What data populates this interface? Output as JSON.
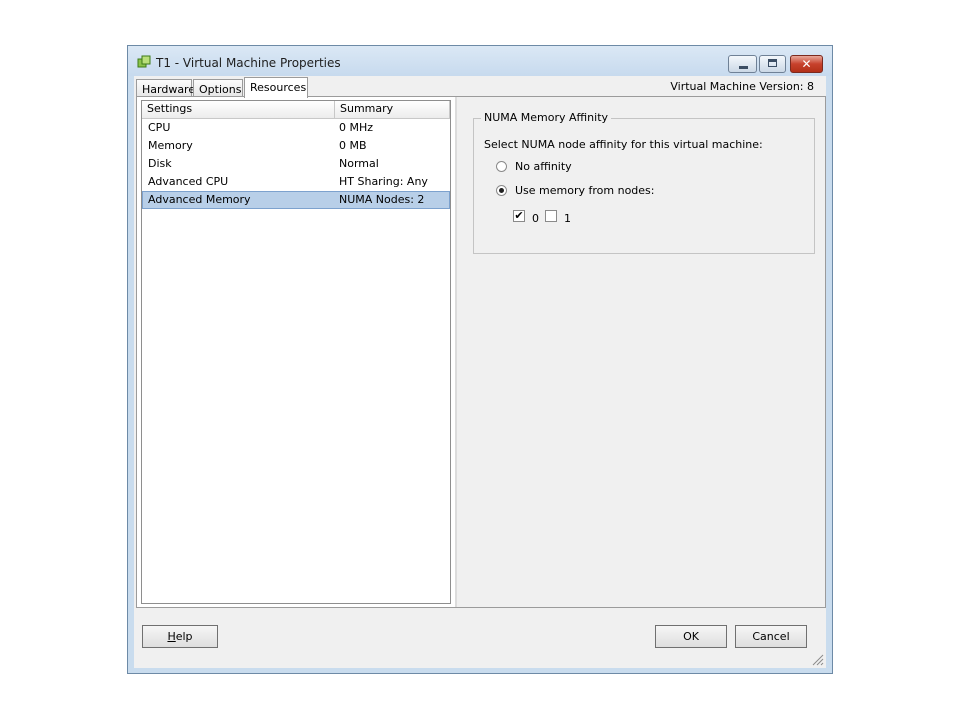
{
  "window": {
    "title": "T1 - Virtual Machine Properties",
    "close_symbol": "✕"
  },
  "tabs": [
    {
      "label": "Hardware",
      "active": false
    },
    {
      "label": "Options",
      "active": false
    },
    {
      "label": "Resources",
      "active": true
    }
  ],
  "vm_version": "Virtual Machine Version: 8",
  "list": {
    "headers": {
      "settings": "Settings",
      "summary": "Summary"
    },
    "rows": [
      {
        "setting": "CPU",
        "summary": "0 MHz"
      },
      {
        "setting": "Memory",
        "summary": "0 MB"
      },
      {
        "setting": "Disk",
        "summary": "Normal"
      },
      {
        "setting": "Advanced CPU",
        "summary": "HT Sharing: Any"
      },
      {
        "setting": "Advanced Memory",
        "summary": "NUMA Nodes: 2"
      }
    ],
    "selected_index": 4
  },
  "numa": {
    "group_title": "NUMA Memory Affinity",
    "description": "Select NUMA node affinity for this virtual machine:",
    "radio_no_affinity": "No affinity",
    "radio_use_nodes": "Use memory from nodes:",
    "selected_option": "use_nodes",
    "node0_label": "0",
    "node0_checked": true,
    "node1_label": "1",
    "node1_checked": false,
    "check_mark": "✔"
  },
  "buttons": {
    "help_underlined": "H",
    "help_rest": "elp",
    "ok": "OK",
    "cancel": "Cancel"
  },
  "icons": {
    "app": "vm-app-icon",
    "minimize": "minimize-icon",
    "maximize": "maximize-icon",
    "close": "close-icon",
    "resize": "resize-grip-icon"
  },
  "colors": {
    "selection": "#b8cfe8",
    "close_button": "#c7412c",
    "app_icon": "#5aa02c"
  }
}
